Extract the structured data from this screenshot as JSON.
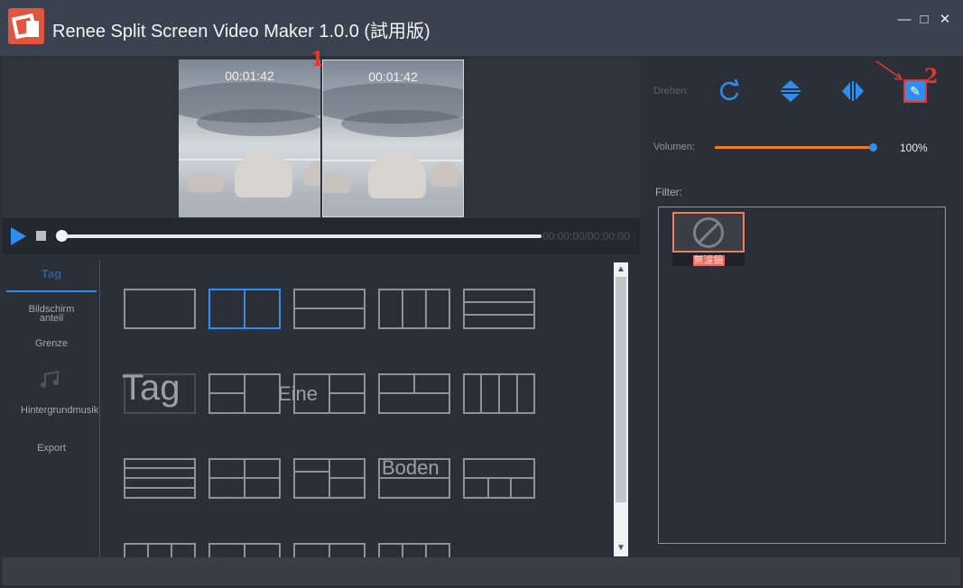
{
  "window": {
    "title": "Renee Split Screen Video Maker 1.0.0 (試用版)",
    "minimize_icon": "minimize-icon",
    "maximize_icon": "maximize-icon",
    "close_icon": "close-icon"
  },
  "preview": {
    "pane1_time": "00:01:42",
    "pane2_time": "00:01:42",
    "marker1": "1"
  },
  "controls": {
    "time_readout": "00:00:00/00:00:00"
  },
  "sidenav": {
    "items": [
      {
        "label": "Tag"
      },
      {
        "label": "Bildschirm anteil"
      },
      {
        "label": "Grenze"
      },
      {
        "label": "Hintergrundmusik"
      },
      {
        "label": "Export"
      }
    ]
  },
  "layout_overlays": {
    "tag": "Tag",
    "eine": "Eine",
    "boden": "Boden"
  },
  "right_panel": {
    "rotate_label": "Drehen:",
    "marker2": "2",
    "volume_label": "Volumen:",
    "volume_value": "100%",
    "volume_level": 1.0,
    "filter_label": "Filter:",
    "filter_item": "無濾鏡"
  },
  "colors": {
    "accent": "#2f8df0",
    "highlight": "#e8352c",
    "volume_bar": "#ef7d1f"
  }
}
